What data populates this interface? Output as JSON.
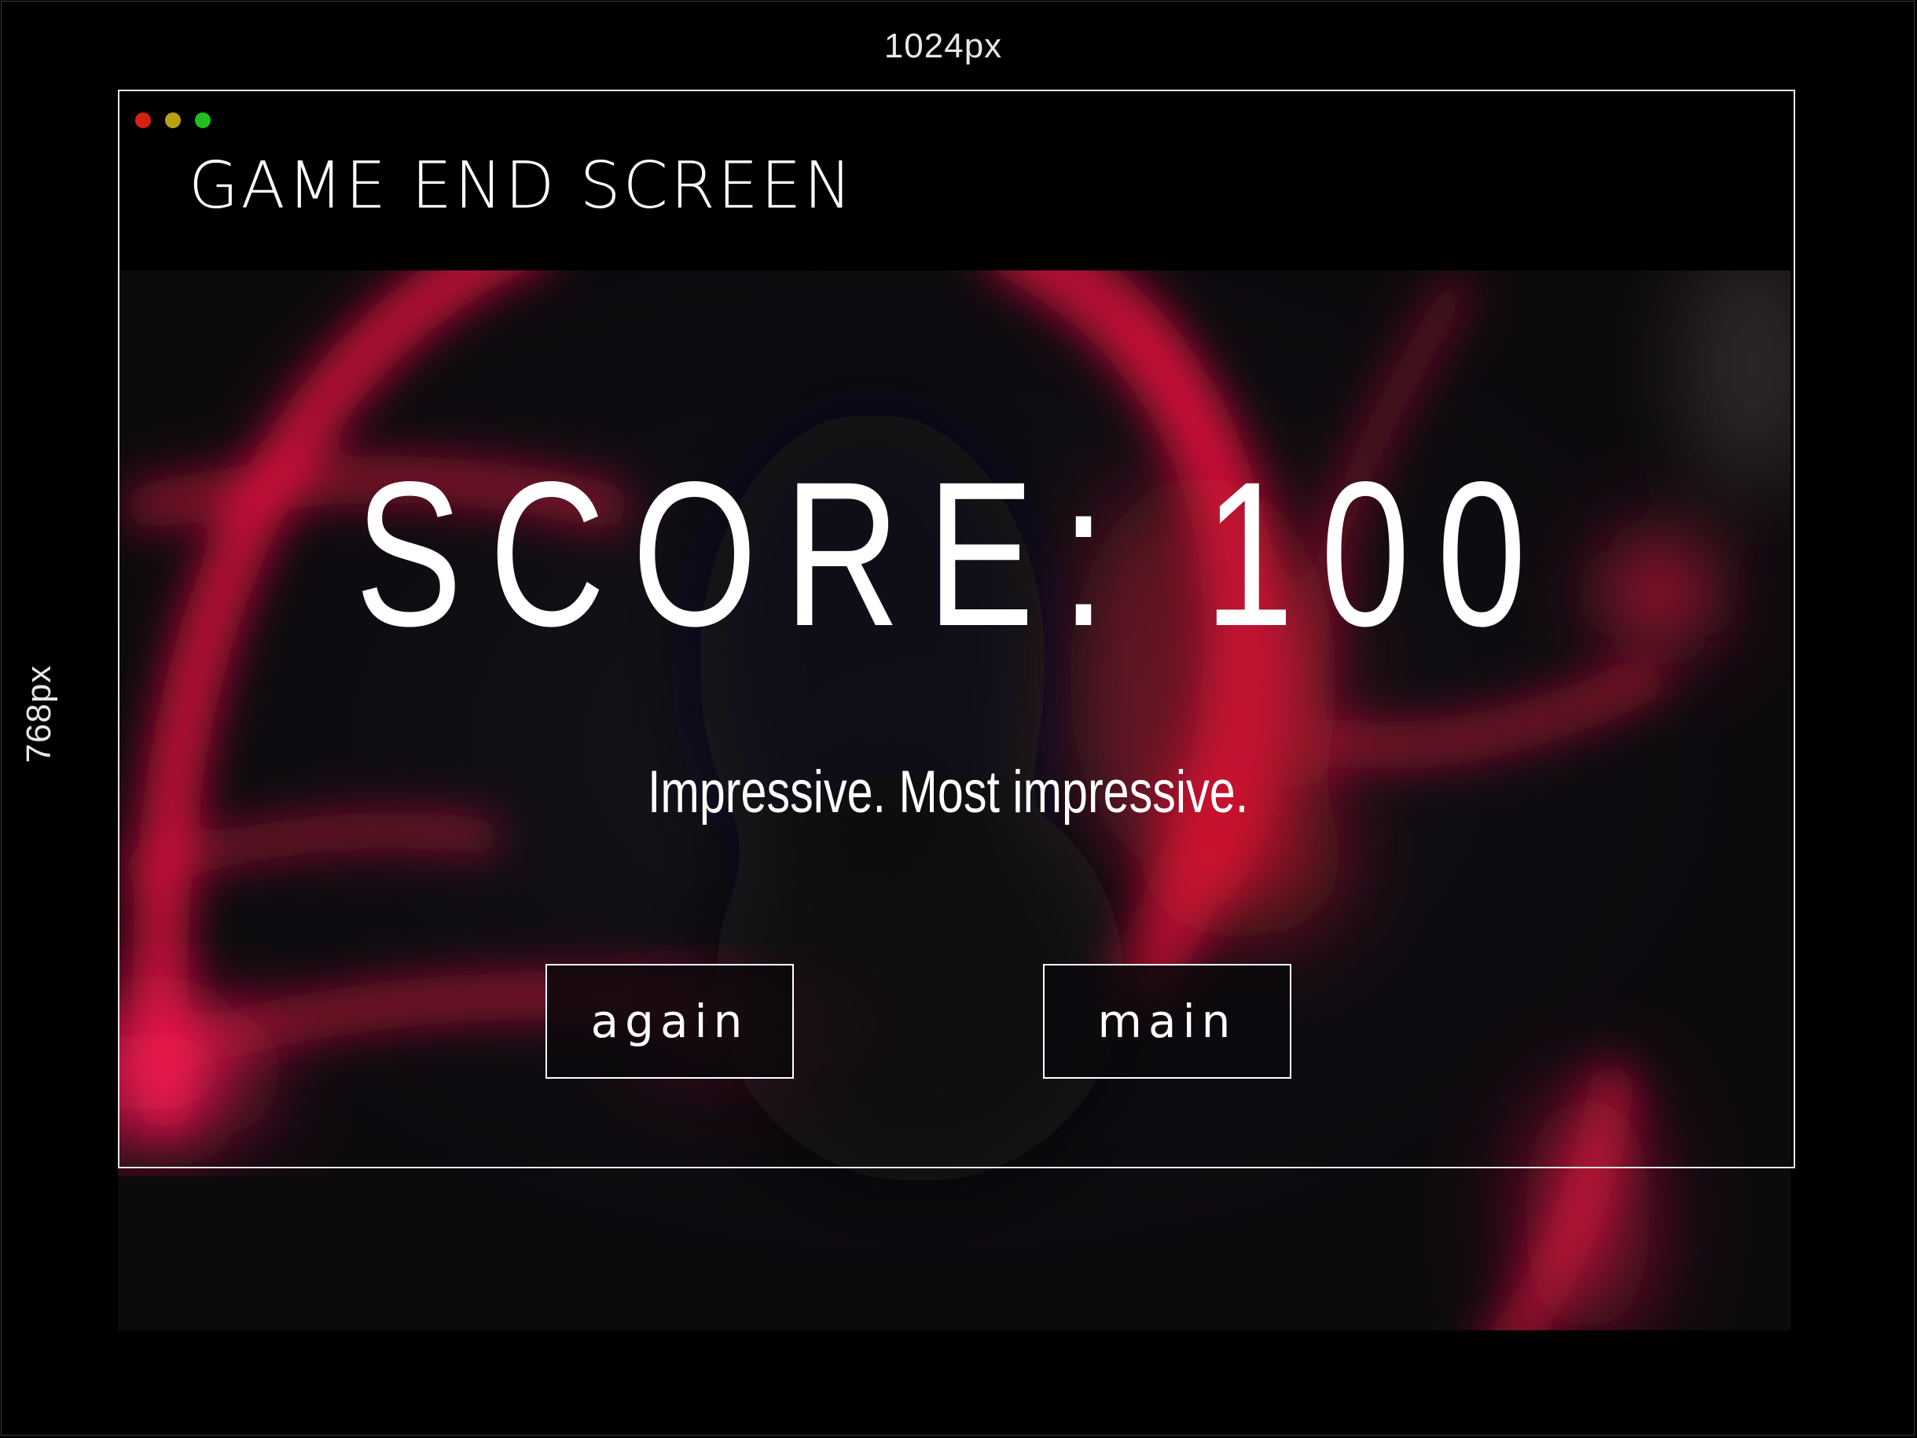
{
  "annotations": {
    "width_label": "1024px",
    "height_label": "768px"
  },
  "window": {
    "title": "GAME END SCREEN",
    "controls": {
      "close_color": "#d9200f",
      "minimize_color": "#b8a012",
      "maximize_color": "#1fbf1f"
    }
  },
  "game": {
    "score_text": "SCORE: 100",
    "message": "Impressive. Most impressive.",
    "buttons": {
      "again_label": "again",
      "main_label": "main"
    },
    "accent_color": "#e0143c",
    "background_color": "#0e0b10"
  }
}
